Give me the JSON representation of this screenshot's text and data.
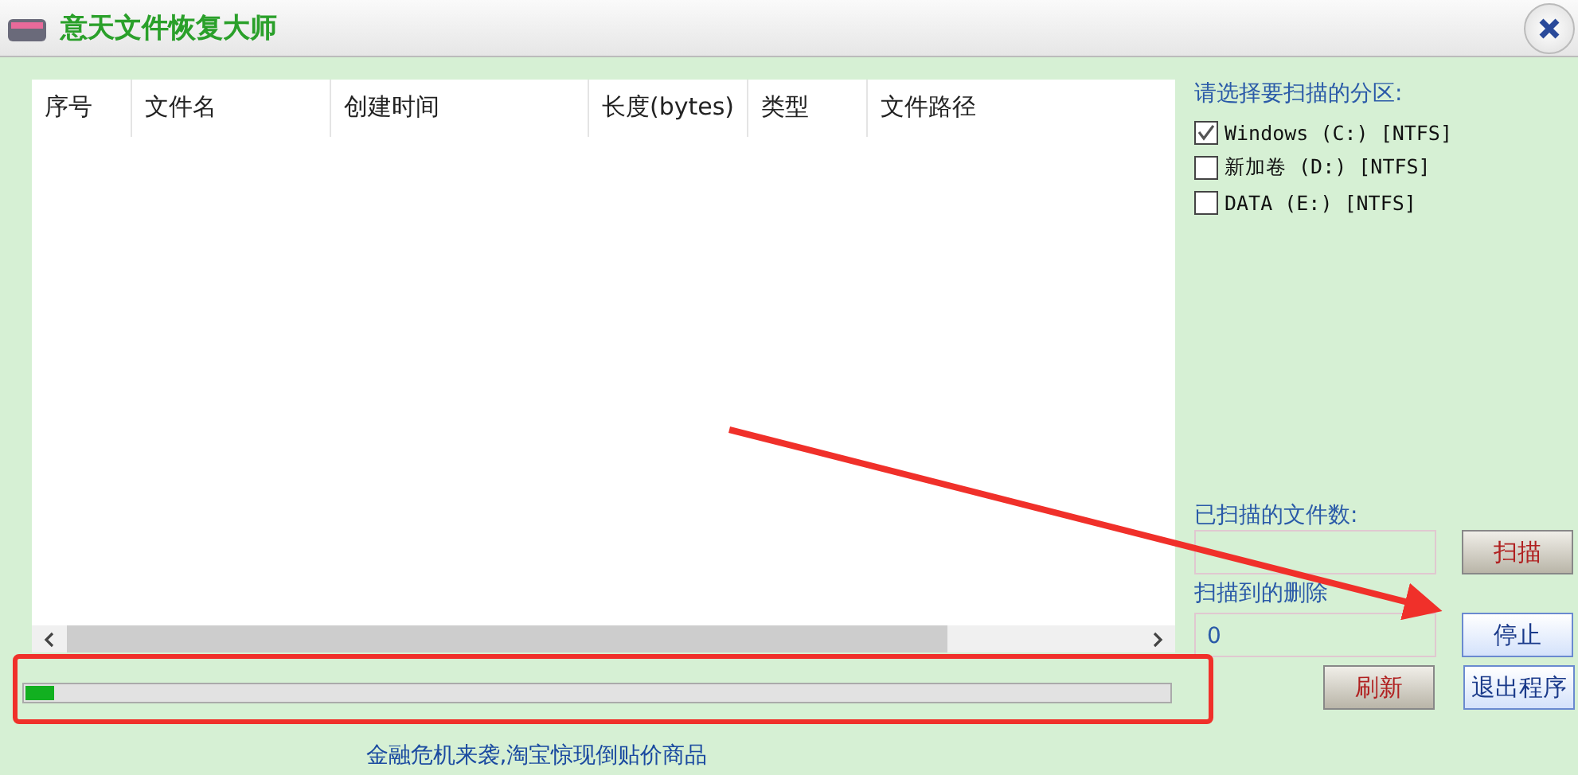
{
  "window": {
    "title": "意天文件恢复大师"
  },
  "table": {
    "columns": [
      "序号",
      "文件名",
      "创建时间",
      "长度(bytes)",
      "类型",
      "文件路径"
    ]
  },
  "partitions": {
    "label": "请选择要扫描的分区:",
    "items": [
      {
        "label": "Windows (C:) [NTFS]",
        "checked": true
      },
      {
        "label": "新加卷 (D:) [NTFS]",
        "checked": false
      },
      {
        "label": "DATA (E:) [NTFS]",
        "checked": false
      }
    ]
  },
  "scanned": {
    "label": "已扫描的文件数:"
  },
  "deleted": {
    "label": "扫描到的删除",
    "value": "0"
  },
  "buttons": [
    {
      "kind": "scan",
      "label": "扫描"
    },
    {
      "kind": "stop",
      "label": "停止"
    }
  ],
  "progress": {
    "level": 0.025
  },
  "refresh_button": {
    "label": "刷新"
  },
  "exit_button": {
    "label": "退出程序"
  },
  "footer_link": "金融危机来袭,淘宝惊现倒贴价商品"
}
